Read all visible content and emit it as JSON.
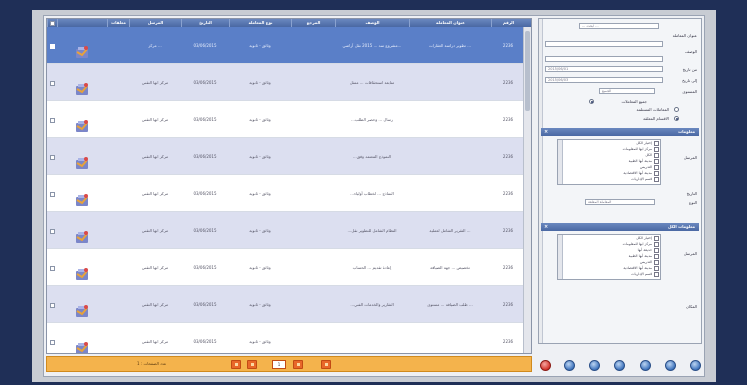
{
  "grid": {
    "columns": [
      {
        "key": "sel",
        "label": "",
        "w": 10
      },
      {
        "key": "icon",
        "label": "",
        "w": 50
      },
      {
        "key": "status",
        "label": "معلقات",
        "w": 22
      },
      {
        "key": "sender",
        "label": "المرسل",
        "w": 52
      },
      {
        "key": "date",
        "label": "التاريخ",
        "w": 48
      },
      {
        "key": "type",
        "label": "نوع المعاملة",
        "w": 62
      },
      {
        "key": "dept",
        "label": "المرجع",
        "w": 44
      },
      {
        "key": "desc",
        "label": "الوصف",
        "w": 74
      },
      {
        "key": "subject",
        "label": "عنوان المعاملة",
        "w": 82
      },
      {
        "key": "id",
        "label": "الرقم",
        "w": 34
      }
    ],
    "rows": [
      {
        "sender": "مركز ...",
        "date": "03/06/2015",
        "type": "وثائق - ثانوية",
        "dept": "",
        "desc": "مشروع سد ... 2015 نقل أراضي...",
        "subject": "تطوير دراسة العقارات ...",
        "id": "2236",
        "selected": true
      },
      {
        "sender": "مركز ابها التقني",
        "date": "03/06/2015",
        "type": "وثائق - ثانوية",
        "dept": "",
        "desc": "متابعة استحقاقات ... ممثل",
        "subject": "",
        "id": "2236",
        "selected": false
      },
      {
        "sender": "مركز ابها التقني",
        "date": "03/06/2015",
        "type": "وثائق - ثانوية",
        "dept": "",
        "desc": "...رسال ... وحصر الطلب",
        "subject": "",
        "id": "2236",
        "selected": false
      },
      {
        "sender": "مركز ابها التقني",
        "date": "03/06/2015",
        "type": "وثائق - ثانوية",
        "dept": "",
        "desc": "...النموذج المعتمد وفق",
        "subject": "",
        "id": "2236",
        "selected": false
      },
      {
        "sender": "مركز ابها التقني",
        "date": "03/06/2015",
        "type": "وثائق - ثانوية",
        "dept": "",
        "desc": "...النماذج ... لخطاب أولياء",
        "subject": "",
        "id": "2236",
        "selected": false
      },
      {
        "sender": "مركز ابها التقني",
        "date": "03/06/2015",
        "type": "وثائق - ثانوية",
        "dept": "",
        "desc": "...النظام الشامل للتطوير نقل",
        "subject": "التقرير الشامل لعملية ...",
        "id": "2236",
        "selected": false
      },
      {
        "sender": "مركز ابها التقني",
        "date": "03/06/2015",
        "type": "وثائق - ثانوية",
        "dept": "",
        "desc": "إعادة تقديم ... الحساب",
        "subject": "تخصيص ... جهة الضيافة",
        "id": "2236",
        "selected": false
      },
      {
        "sender": "مركز ابها التقني",
        "date": "03/06/2015",
        "type": "وثائق - ثانوية",
        "dept": "",
        "desc": "...التقارير والخدمات الفني",
        "subject": "طلب الضيافة ... مستوى ...",
        "id": "2236",
        "selected": false
      },
      {
        "sender": "مركز ابها التقني",
        "date": "03/06/2015",
        "type": "وثائق - ثانوية",
        "dept": "",
        "desc": "",
        "subject": "",
        "id": "2236",
        "selected": false
      }
    ]
  },
  "pager": {
    "page": "1",
    "label": "عدد الصفحات : 1"
  },
  "panel": {
    "search_hint": "... ابحث ...",
    "subject_label": "عنوان المعاملة",
    "subject_value": "",
    "desc_label": "الوصف",
    "desc_value": "",
    "from_label": "من تاريخ",
    "from_value": "2015/06/01",
    "to_label": "إلى تاريخ",
    "to_value": "2015/06/03",
    "level_label": "المستوى",
    "level_value": "الجميع",
    "radio_all": "جميع المعاملات",
    "option1": "المعاملات المستلمة",
    "option2": "الاقسام المعلقة",
    "section1_title": "معلومات",
    "section1_label": "المرسل",
    "section1_items": [
      "إختيار الكل",
      "مركز ابها للمعلومات",
      "الكل",
      "مدينة أبها الطبية",
      "التدريس",
      "مدينة أبها الاقتصادية",
      "قسم الإداريات"
    ],
    "date_label": "التاريخ",
    "category_label": "النوع",
    "category_value": "المعاملة المعلقة",
    "section2_title": "معلومات الكل",
    "section2_label": "المرسل",
    "section2_items": [
      "إختيار الكل",
      "مركز ابها للمعلومات",
      "حديقة أبها",
      "مدينة أبها الطبية",
      "التدريس",
      "مدينة أبها الاقتصادية",
      "قسم الإداريات"
    ],
    "footer_label": "المكان"
  },
  "colors": {
    "header": "#4a68a3",
    "selected_row": "#5a7fc8",
    "alt_row": "#dcdff0",
    "pager": "#f4b34c",
    "pager_btn": "#e8672a"
  }
}
